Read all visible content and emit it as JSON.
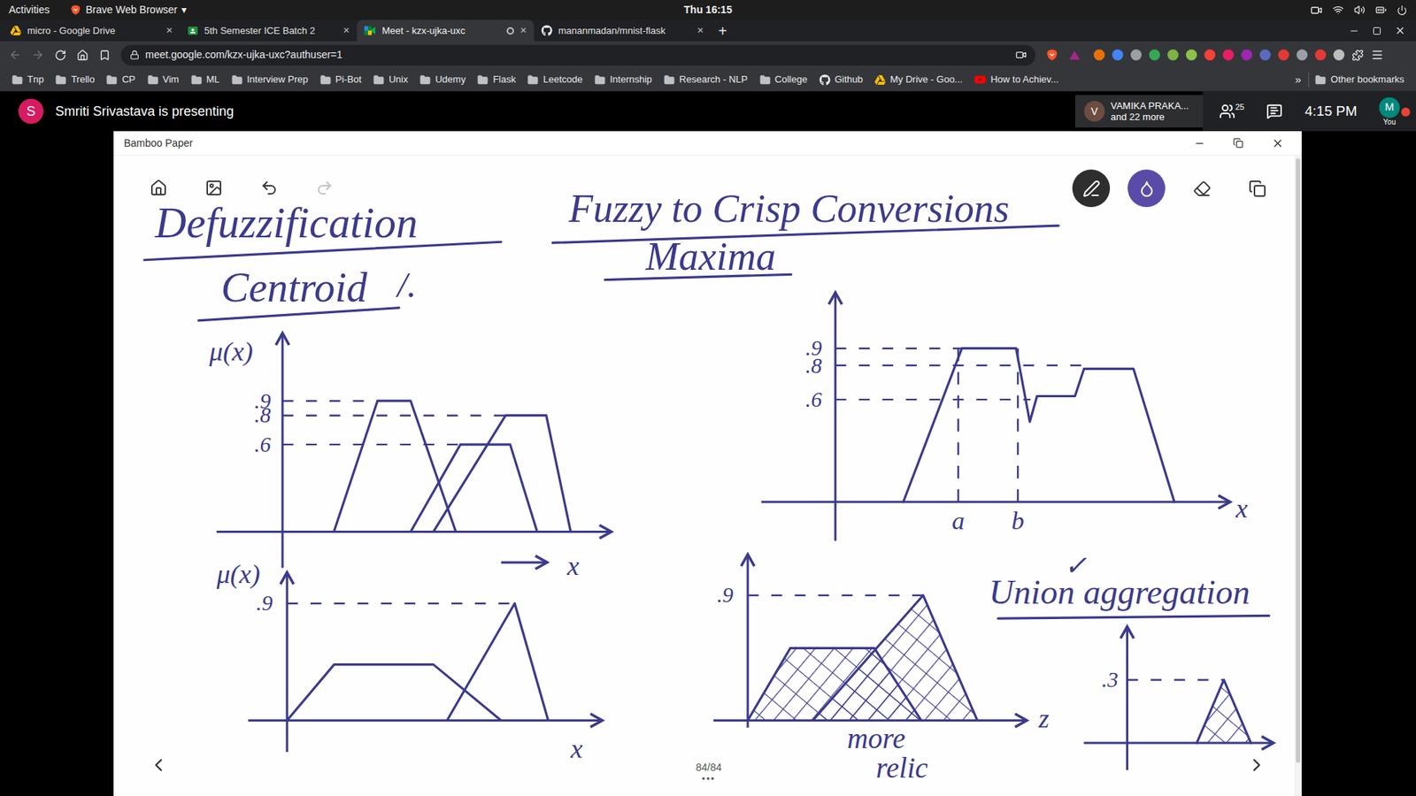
{
  "top_bar": {
    "activities": "Activities",
    "app_menu": "Brave Web Browser",
    "app_menu_arrow": "▾",
    "clock": "Thu 16:15"
  },
  "tabs": [
    {
      "label": "micro - Google Drive",
      "icon": "drive",
      "selected": false,
      "recording": false,
      "close": "×"
    },
    {
      "label": "5th Semester ICE Batch 2",
      "icon": "classroom",
      "selected": false,
      "recording": false,
      "close": "×"
    },
    {
      "label": "Meet - kzx-ujka-uxc",
      "icon": "meet",
      "selected": true,
      "recording": true,
      "close": "×"
    },
    {
      "label": "mananmadan/mnist-flask",
      "icon": "github",
      "selected": false,
      "recording": false,
      "close": "×"
    }
  ],
  "new_tab": "+",
  "address_bar": {
    "url": "meet.google.com/kzx-ujka-uxc?authuser=1",
    "back_disabled": true,
    "forward_disabled": true
  },
  "bookmarks": [
    {
      "label": "Tnp",
      "kind": "folder"
    },
    {
      "label": "Trello",
      "kind": "folder"
    },
    {
      "label": "CP",
      "kind": "folder"
    },
    {
      "label": "Vim",
      "kind": "folder"
    },
    {
      "label": "ML",
      "kind": "folder"
    },
    {
      "label": "Interview Prep",
      "kind": "folder"
    },
    {
      "label": "Pi-Bot",
      "kind": "folder"
    },
    {
      "label": "Unix",
      "kind": "folder"
    },
    {
      "label": "Udemy",
      "kind": "folder"
    },
    {
      "label": "Flask",
      "kind": "folder"
    },
    {
      "label": "Leetcode",
      "kind": "folder"
    },
    {
      "label": "Internship",
      "kind": "folder"
    },
    {
      "label": "Research - NLP",
      "kind": "folder"
    },
    {
      "label": "College",
      "kind": "folder"
    },
    {
      "label": "Github",
      "kind": "github"
    },
    {
      "label": "My Drive - Goo...",
      "kind": "drive"
    },
    {
      "label": "How to Achiev...",
      "kind": "youtube"
    }
  ],
  "bookmarks_overflow": "»",
  "other_bookmarks": "Other bookmarks",
  "meet": {
    "presenter_initial": "S",
    "presenter_text": "Smriti Srivastava is presenting",
    "participant_initial": "V",
    "participant_name": "VAMIKA PRAKA...",
    "participant_more": "and 22 more",
    "participant_count": "25",
    "time": "4:15 PM",
    "you_initial": "M",
    "you_label": "You"
  },
  "window": {
    "title": "Bamboo Paper",
    "page": "84/84",
    "more": "•••"
  },
  "tools_left": [
    {
      "name": "home",
      "disabled": false
    },
    {
      "name": "gallery",
      "disabled": false
    },
    {
      "name": "undo",
      "disabled": false
    },
    {
      "name": "redo",
      "disabled": true
    }
  ],
  "tools_right": [
    {
      "name": "pen",
      "selected": true
    },
    {
      "name": "color",
      "selected": false,
      "color": "#5b4ba8"
    },
    {
      "name": "eraser",
      "selected": false
    },
    {
      "name": "crop",
      "selected": false
    }
  ],
  "drawing": {
    "title": "Defuzzification",
    "subtitle": "Fuzzy to Crisp Conversions",
    "method_1": "Centroid",
    "method_1_mark": "/.",
    "method_2": "Maxima",
    "union_label": "Union aggregation",
    "union_mark": "✓",
    "note": [
      "more",
      "relic"
    ],
    "charts": {
      "centroid": {
        "y_label": "μ(x)",
        "x_label": "x",
        "shaded": false,
        "markers": [],
        "ticks": [
          {
            "label": ".9",
            "value": 0.9,
            "guide_to": 2.92
          },
          {
            "label": ".8",
            "value": 0.8,
            "guide_to": 6.86
          },
          {
            "label": ".6",
            "value": 0.6,
            "guide_to": 5.47
          }
        ],
        "series": [
          {
            "x": [
              1.58,
              2.92,
              3.94,
              5.33
            ],
            "y": [
              0,
              0.9,
              0.9,
              0
            ]
          },
          {
            "x": [
              3.94,
              5.47,
              7.0,
              7.83
            ],
            "y": [
              0,
              0.6,
              0.6,
              0
            ]
          },
          {
            "x": [
              4.64,
              6.86,
              8.11,
              8.86
            ],
            "y": [
              0,
              0.8,
              0.8,
              0
            ]
          }
        ]
      },
      "maxima": {
        "x_label": "x",
        "shaded": false,
        "ticks": [
          {
            "label": ".9",
            "value": 0.9,
            "guide_to": 3.5
          },
          {
            "label": ".8",
            "value": 0.8,
            "guide_to": 7.0
          },
          {
            "label": ".6",
            "value": 0.6,
            "guide_to": 5.4
          }
        ],
        "markers": [
          {
            "label": "a",
            "x": 3.4
          },
          {
            "label": "b",
            "x": 5.05
          }
        ],
        "series": [
          {
            "x": [
              1.88,
              3.5,
              5.0,
              5.38,
              5.58,
              6.63,
              6.88,
              8.25,
              9.38
            ],
            "y": [
              0,
              0.9,
              0.9,
              0.47,
              0.62,
              0.62,
              0.78,
              0.78,
              0
            ]
          }
        ]
      },
      "sketch": {
        "y_label": "μ(x)",
        "x_label": "x",
        "shaded": false,
        "markers": [],
        "ticks": [
          {
            "label": ".9",
            "value": 0.9,
            "guide_to": 7.2
          }
        ],
        "series": [
          {
            "x": [
              0,
              1.49,
              4.63,
              6.77
            ],
            "y": [
              0,
              0.43,
              0.43,
              0
            ]
          },
          {
            "x": [
              5.06,
              7.2,
              8.26
            ],
            "y": [
              0,
              0.9,
              0
            ]
          }
        ]
      },
      "union": {
        "x_label": "z",
        "shaded": true,
        "markers": [],
        "ticks": [
          {
            "label": ".9",
            "value": 0.9,
            "guide_to": 6.47
          }
        ],
        "series": [
          {
            "x": [
              0,
              1.57,
              4.67,
              6.4
            ],
            "y": [
              0,
              0.52,
              0.52,
              0
            ]
          },
          {
            "x": [
              2.4,
              6.47,
              8.47
            ],
            "y": [
              0,
              0.9,
              0
            ]
          }
        ]
      },
      "result": {
        "shaded": true,
        "markers": [],
        "ticks": [
          {
            "label": ".3",
            "value": 0.3,
            "guide_to": 5.35
          }
        ],
        "series": [
          {
            "x": [
              3.85,
              5.35,
              6.85
            ],
            "y": [
              0,
              0.3,
              0
            ]
          }
        ]
      }
    }
  }
}
